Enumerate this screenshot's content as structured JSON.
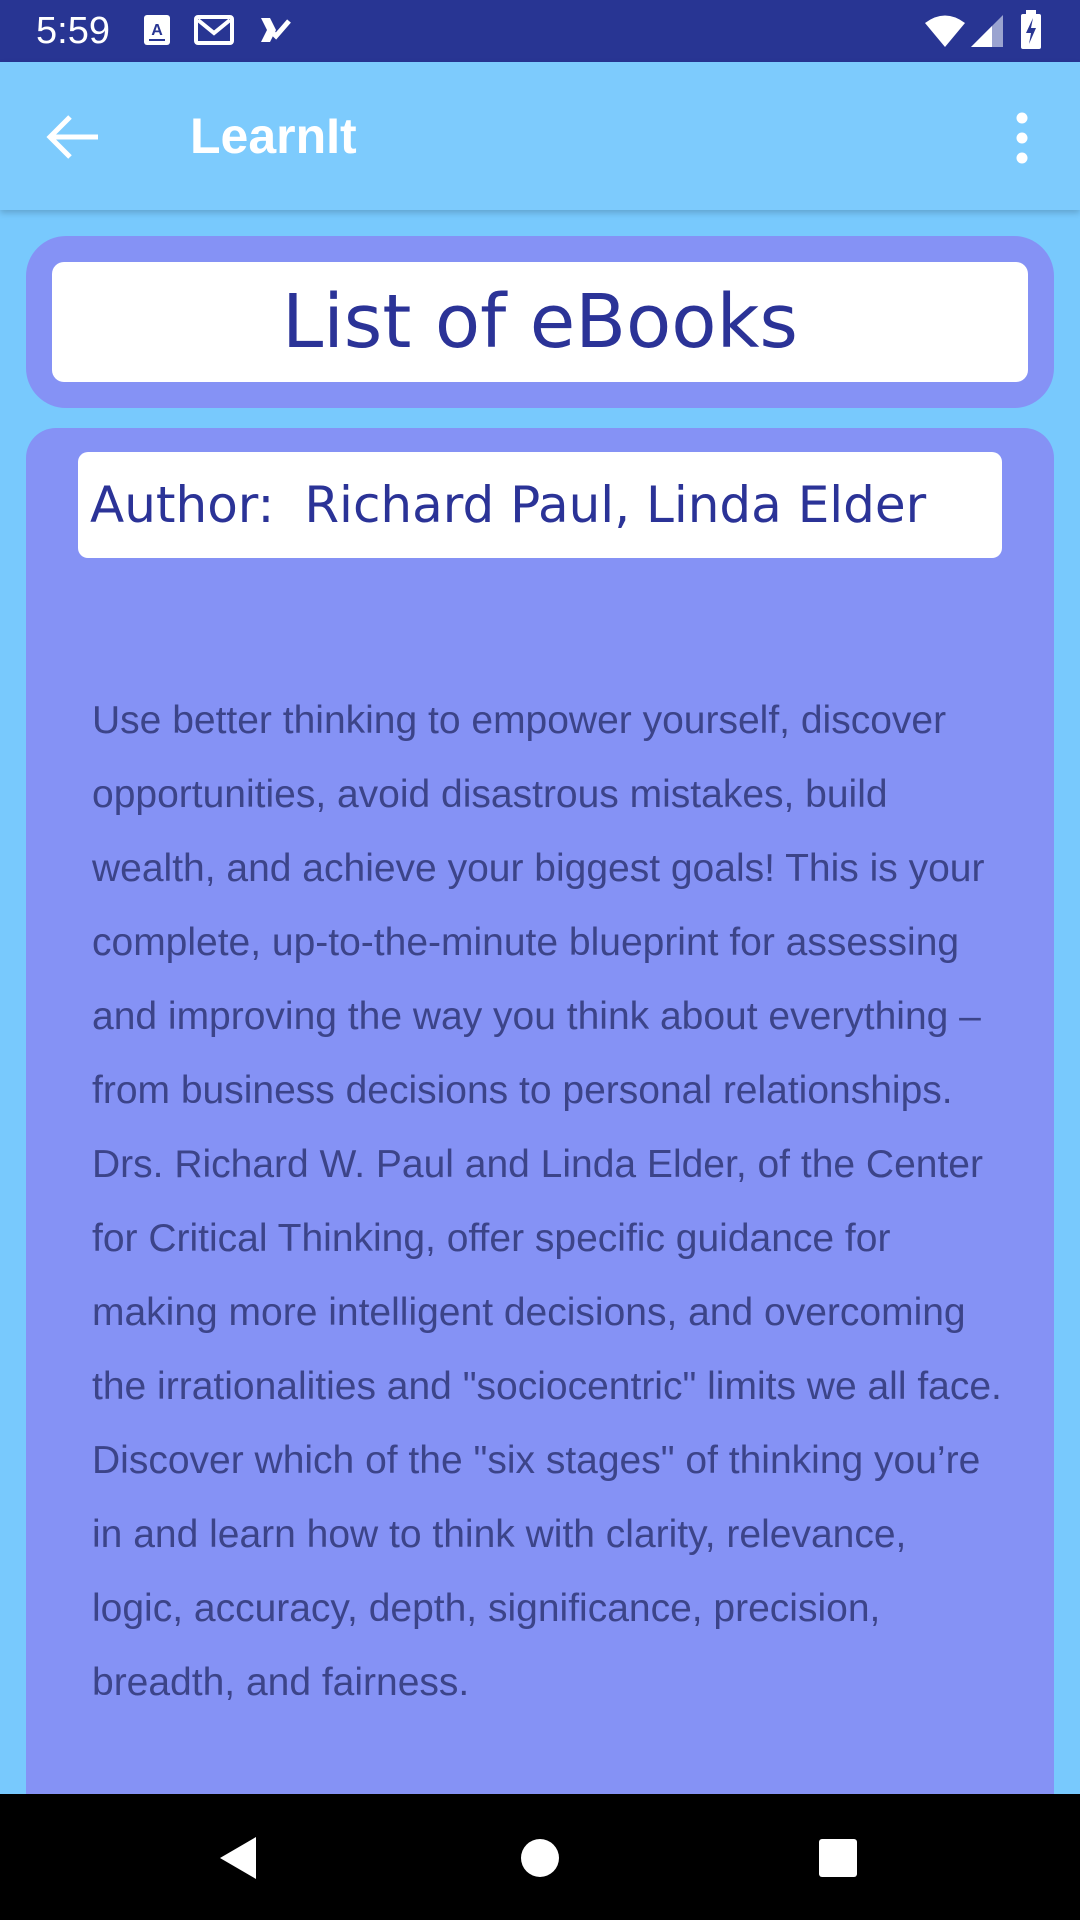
{
  "status_bar": {
    "time": "5:59",
    "left_icons": [
      "a-icon",
      "gmail-icon",
      "task-check-icon"
    ],
    "right_icons": [
      "wifi-icon",
      "signal-icon",
      "battery-charging-icon"
    ],
    "background": "#283593"
  },
  "app_bar": {
    "title": "LearnIt",
    "background": "#7dcbfd"
  },
  "header": {
    "title": "List of eBooks"
  },
  "book": {
    "author_label": "Author:",
    "author": "Richard Paul, Linda Elder",
    "description": "Use better thinking to empower yourself, discover opportunities, avoid disastrous mistakes, build wealth, and achieve your biggest goals! This is your complete, up-to-the-minute blueprint for assessing and improving the way you think about everything – from business decisions to personal relationships. Drs. Richard W. Paul and Linda Elder, of the Center for Critical Thinking, offer specific guidance for making more intelligent decisions, and overcoming the irrationalities and \"sociocentric\" limits we all face. Discover which of the \"six stages\" of thinking you’re in and learn how to think with clarity, relevance, logic, accuracy, depth, significance, precision, breadth, and fairness."
  },
  "colors": {
    "card": "#8592f5",
    "heading_text": "#2b3397",
    "body_text": "#3c4489"
  }
}
